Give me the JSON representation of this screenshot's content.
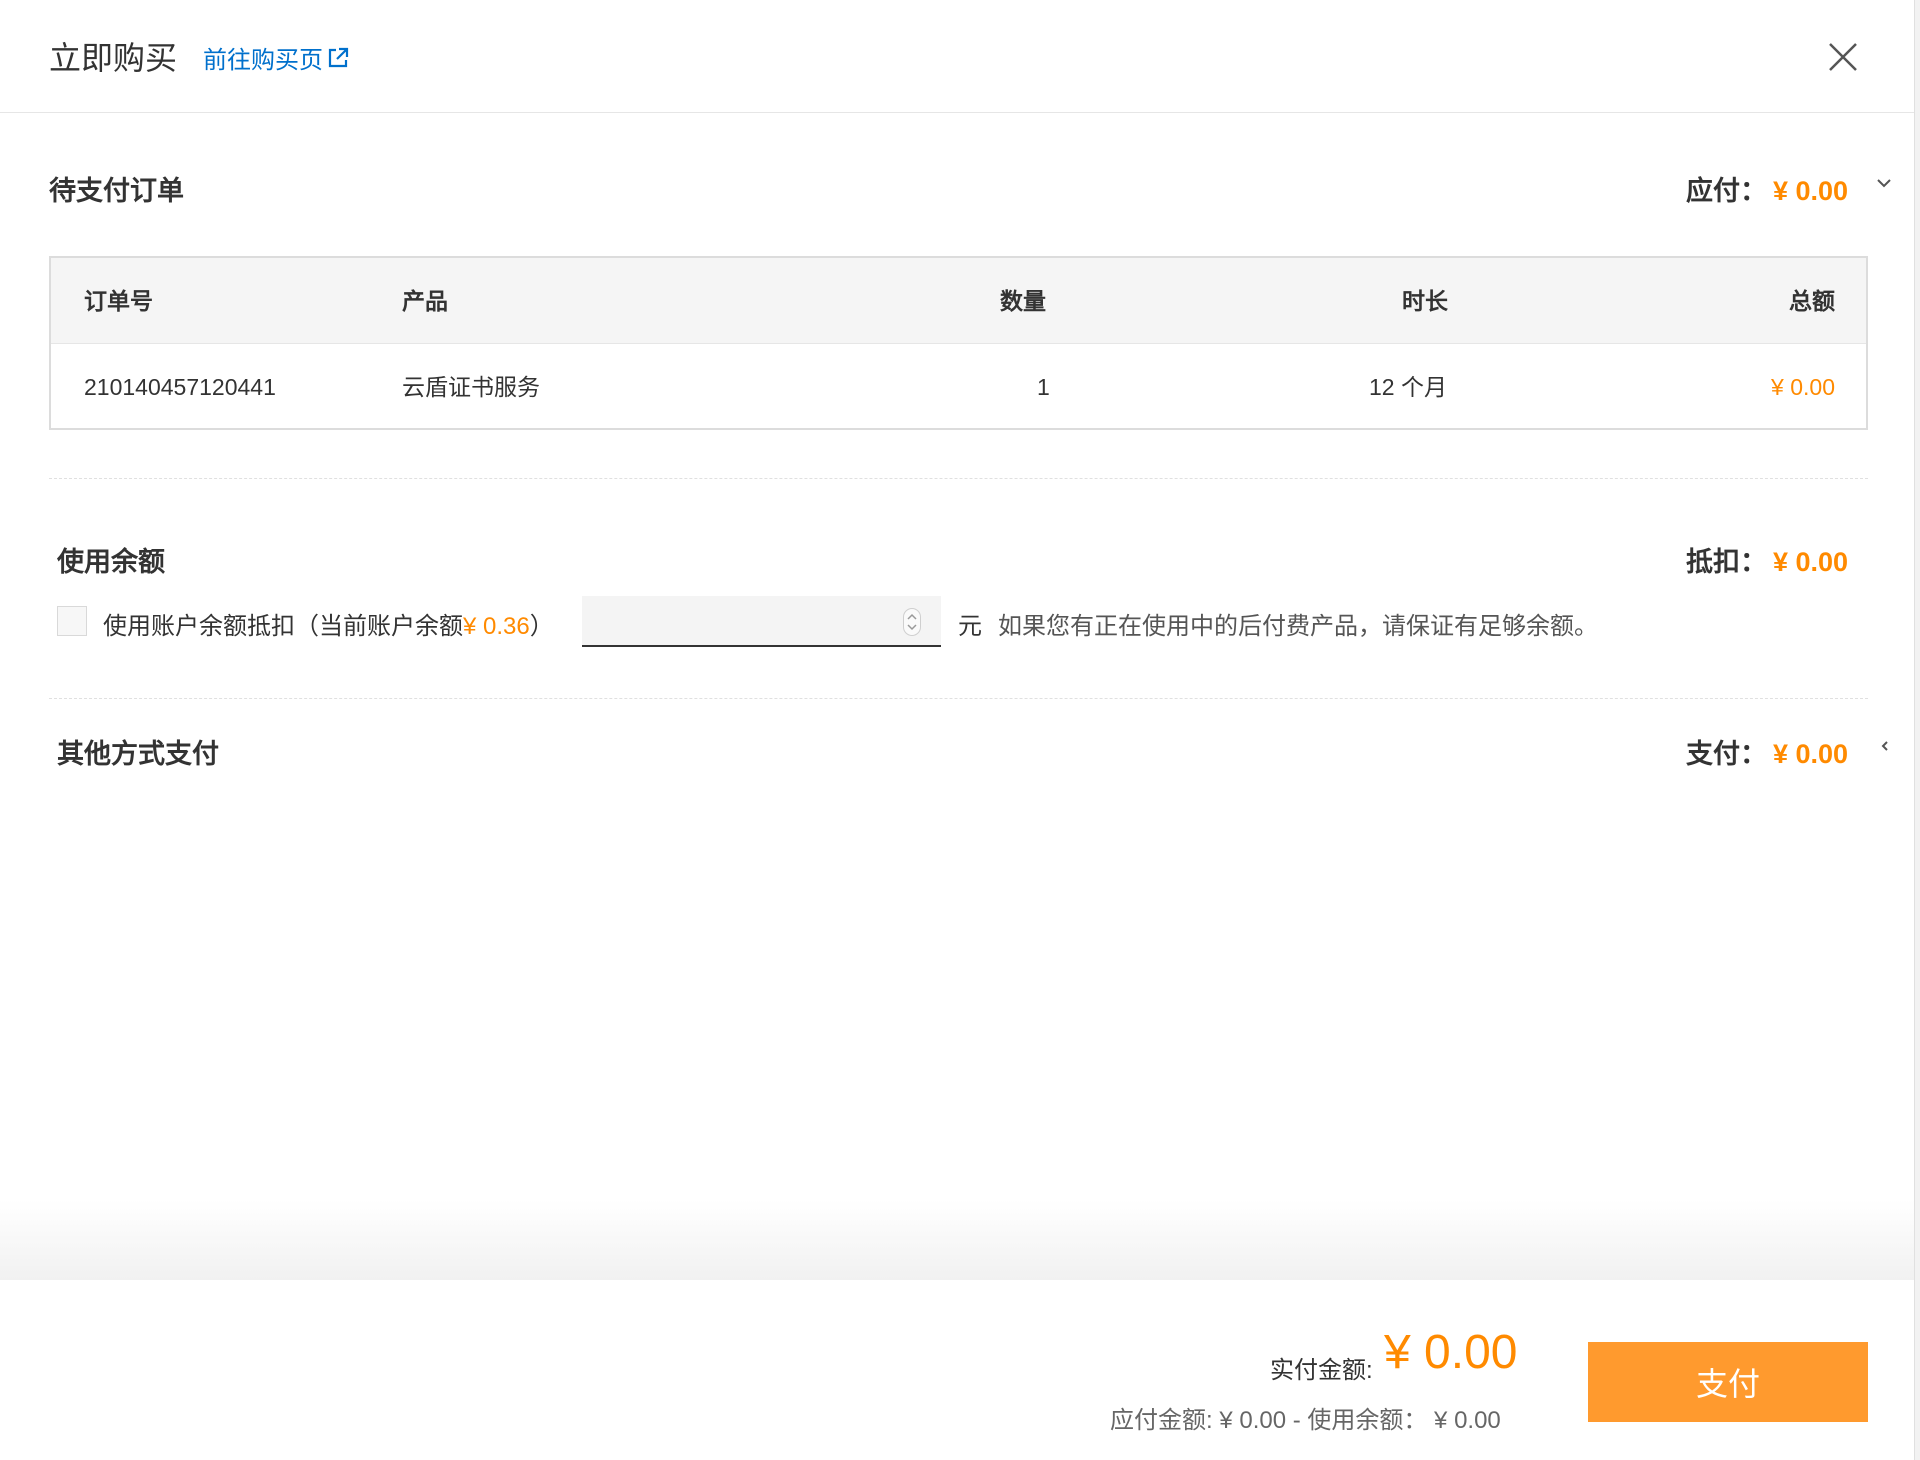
{
  "header": {
    "title": "立即购买",
    "link_label": "前往购买页"
  },
  "pending": {
    "title": "待支付订单",
    "amount_label": "应付：",
    "amount_value": "¥ 0.00",
    "expanded": true
  },
  "table": {
    "headers": {
      "order_no": "订单号",
      "product": "产品",
      "quantity": "数量",
      "duration": "时长",
      "total": "总额"
    },
    "rows": [
      {
        "order_no": "210140457120441",
        "product": "云盾证书服务",
        "quantity": "1",
        "duration": "12 个月",
        "total": "¥ 0.00"
      }
    ]
  },
  "balance": {
    "title": "使用余额",
    "amount_label": "抵扣：",
    "amount_value": "¥ 0.00",
    "checkbox_label_prefix": "使用账户余额抵扣（当前账户余额",
    "balance_value": "¥ 0.36",
    "checkbox_label_suffix": "）",
    "checkbox_checked": false,
    "input_value": "",
    "unit": "元",
    "hint": "如果您有正在使用中的后付费产品，请保证有足够余额。"
  },
  "other": {
    "title": "其他方式支付",
    "amount_label": "支付：",
    "amount_value": "¥ 0.00"
  },
  "footer": {
    "actual_label": "实付金额:",
    "actual_value": "¥ 0.00",
    "formula": "应付金额: ¥ 0.00 - 使用余额： ¥ 0.00",
    "pay_button": "支付"
  },
  "colors": {
    "accent": "#ff8a00",
    "button": "#ff9a2e",
    "link": "#0070cc"
  },
  "icons": {
    "external_link": "external-link-icon",
    "close": "close-icon",
    "chevron_down": "chevron-down-icon",
    "chevron_left": "chevron-left-icon"
  }
}
